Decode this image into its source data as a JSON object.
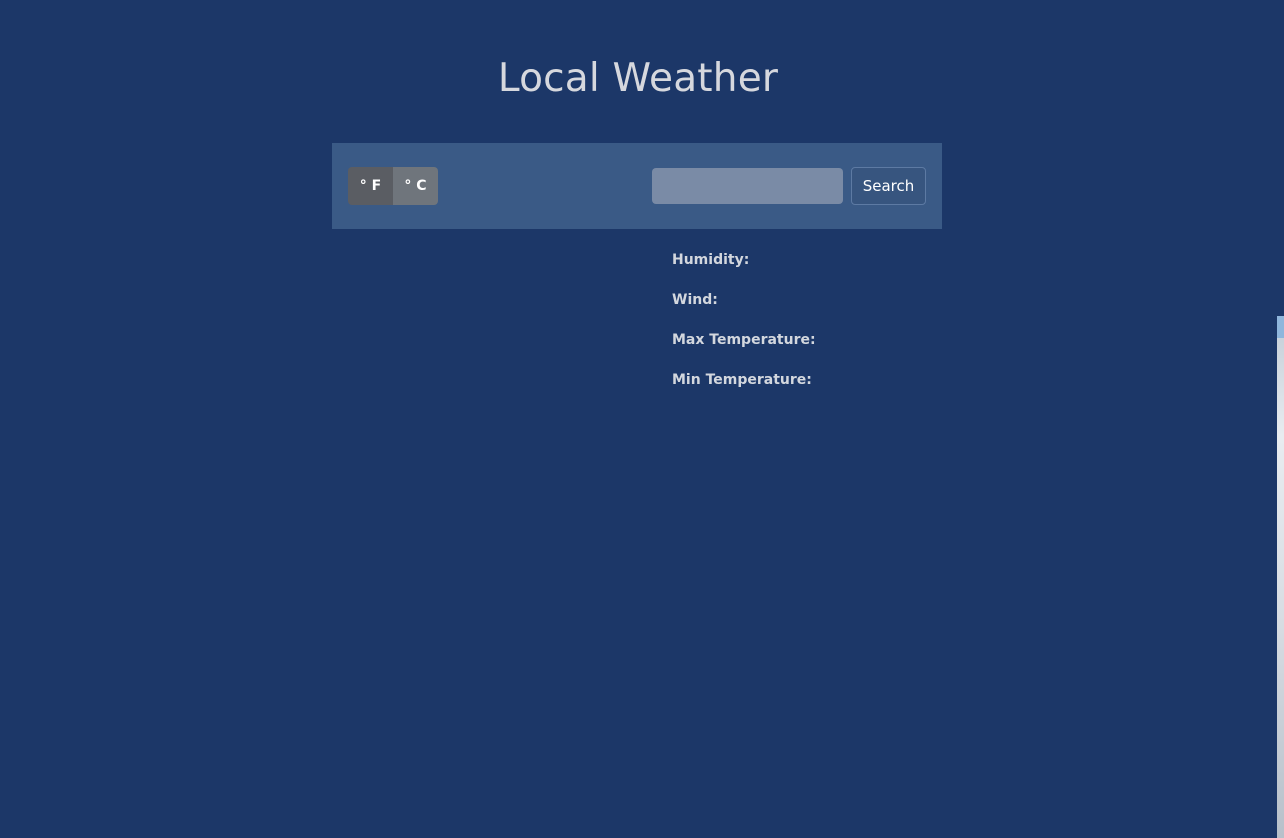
{
  "app": {
    "title": "Local Weather"
  },
  "units": {
    "fahrenheit_label": "° F",
    "celsius_label": "° C"
  },
  "search": {
    "value": "",
    "placeholder": "",
    "button_label": "Search"
  },
  "details": {
    "humidity_label": "Humidity:",
    "wind_label": "Wind:",
    "max_temp_label": "Max Temperature:",
    "min_temp_label": "Min Temperature:"
  },
  "colors": {
    "background": "#1c3768",
    "toolbar": "#3a5a86",
    "text": "#d6d8de"
  }
}
